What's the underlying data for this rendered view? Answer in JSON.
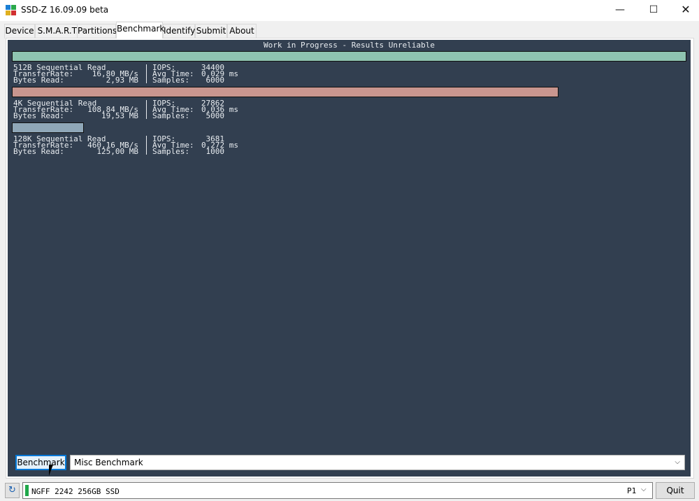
{
  "window": {
    "title": "SSD-Z 16.09.09 beta",
    "controls": {
      "minimize": "—",
      "maximize": "☐",
      "close": "✕"
    }
  },
  "tabs": [
    {
      "label": "Device"
    },
    {
      "label": "S.M.A.R.T."
    },
    {
      "label": "Partitions"
    },
    {
      "label": "Benchmark",
      "active": true
    },
    {
      "label": "Identify"
    },
    {
      "label": "Submit"
    },
    {
      "label": "About"
    }
  ],
  "benchmark": {
    "banner": "Work in Progress - Results Unreliable",
    "results": [
      {
        "name": "512B Sequential Read",
        "transfer_label": "TransferRate:",
        "transfer_value": "16,80 MB/s",
        "bytes_label": "Bytes Read:",
        "bytes_value": "2,93 MB",
        "iops_label": "IOPS:",
        "iops_value": "34400",
        "avg_label": "Avg Time:",
        "avg_value": "0,029 ms",
        "samples_label": "Samples:",
        "samples_value": "6000",
        "bar_color": "#8fc4b0",
        "bar_fraction": 1.0
      },
      {
        "name": "4K Sequential Read",
        "transfer_label": "TransferRate:",
        "transfer_value": "108,84 MB/s",
        "bytes_label": "Bytes Read:",
        "bytes_value": "19,53 MB",
        "iops_label": "IOPS:",
        "iops_value": "27862",
        "avg_label": "Avg Time:",
        "avg_value": "0,036 ms",
        "samples_label": "Samples:",
        "samples_value": "5000",
        "bar_color": "#c9968f",
        "bar_fraction": 0.81
      },
      {
        "name": "128K Sequential Read",
        "transfer_label": "TransferRate:",
        "transfer_value": "460,16 MB/s",
        "bytes_label": "Bytes Read:",
        "bytes_value": "125,00 MB",
        "iops_label": "IOPS:",
        "iops_value": "3681",
        "avg_label": "Avg Time:",
        "avg_value": "0,272 ms",
        "samples_label": "Samples:",
        "samples_value": "1000",
        "bar_color": "#8fa7b8",
        "bar_fraction": 0.107
      }
    ],
    "run_button": "Benchmark",
    "mode_select": "Misc Benchmark"
  },
  "statusbar": {
    "drive_name": "NGFF 2242 256GB SSD",
    "port": "P1",
    "quit_button": "Quit",
    "drive_indicator_color": "#1fa84a"
  }
}
